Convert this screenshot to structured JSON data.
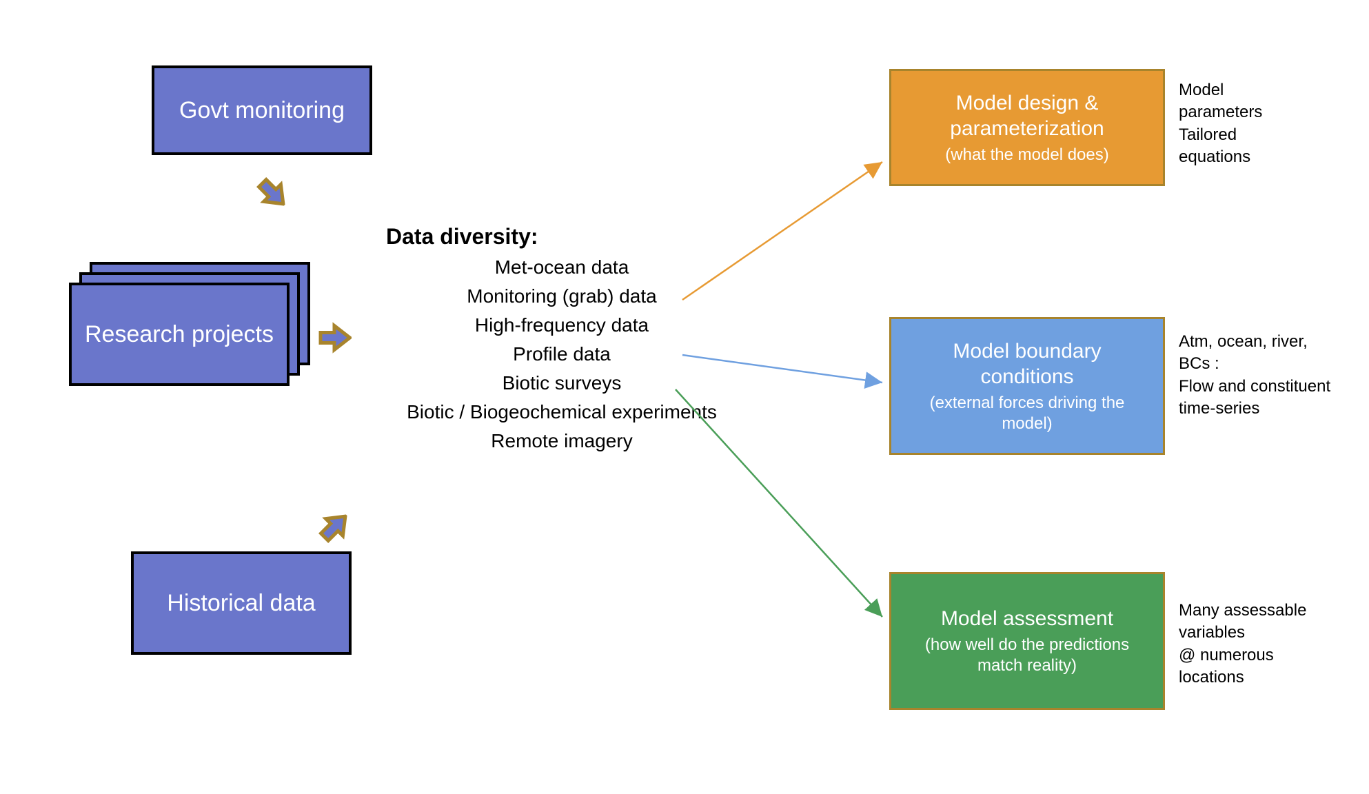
{
  "sources": {
    "govt": "Govt monitoring",
    "research": "Research projects",
    "historical": "Historical data"
  },
  "center": {
    "title": "Data diversity:",
    "items": [
      "Met-ocean data",
      "Monitoring (grab) data",
      "High-frequency data",
      "Profile data",
      "Biotic surveys",
      "Biotic / Biogeochemical experiments",
      "Remote imagery"
    ]
  },
  "outputs": {
    "design": {
      "title": "Model design & parameterization",
      "sub": "(what the model does)",
      "note": "Model\nparameters\nTailored\nequations",
      "color": "#e79a33"
    },
    "boundary": {
      "title": "Model boundary conditions",
      "sub": "(external forces driving the model)",
      "note": "Atm, ocean, river,\nBCs :\nFlow and constituent\ntime-series",
      "color": "#6fa0e0"
    },
    "assessment": {
      "title": "Model assessment",
      "sub": "(how well do the predictions match reality)",
      "note": "Many assessable\nvariables\n@ numerous\nlocations",
      "color": "#4a9e58"
    }
  }
}
